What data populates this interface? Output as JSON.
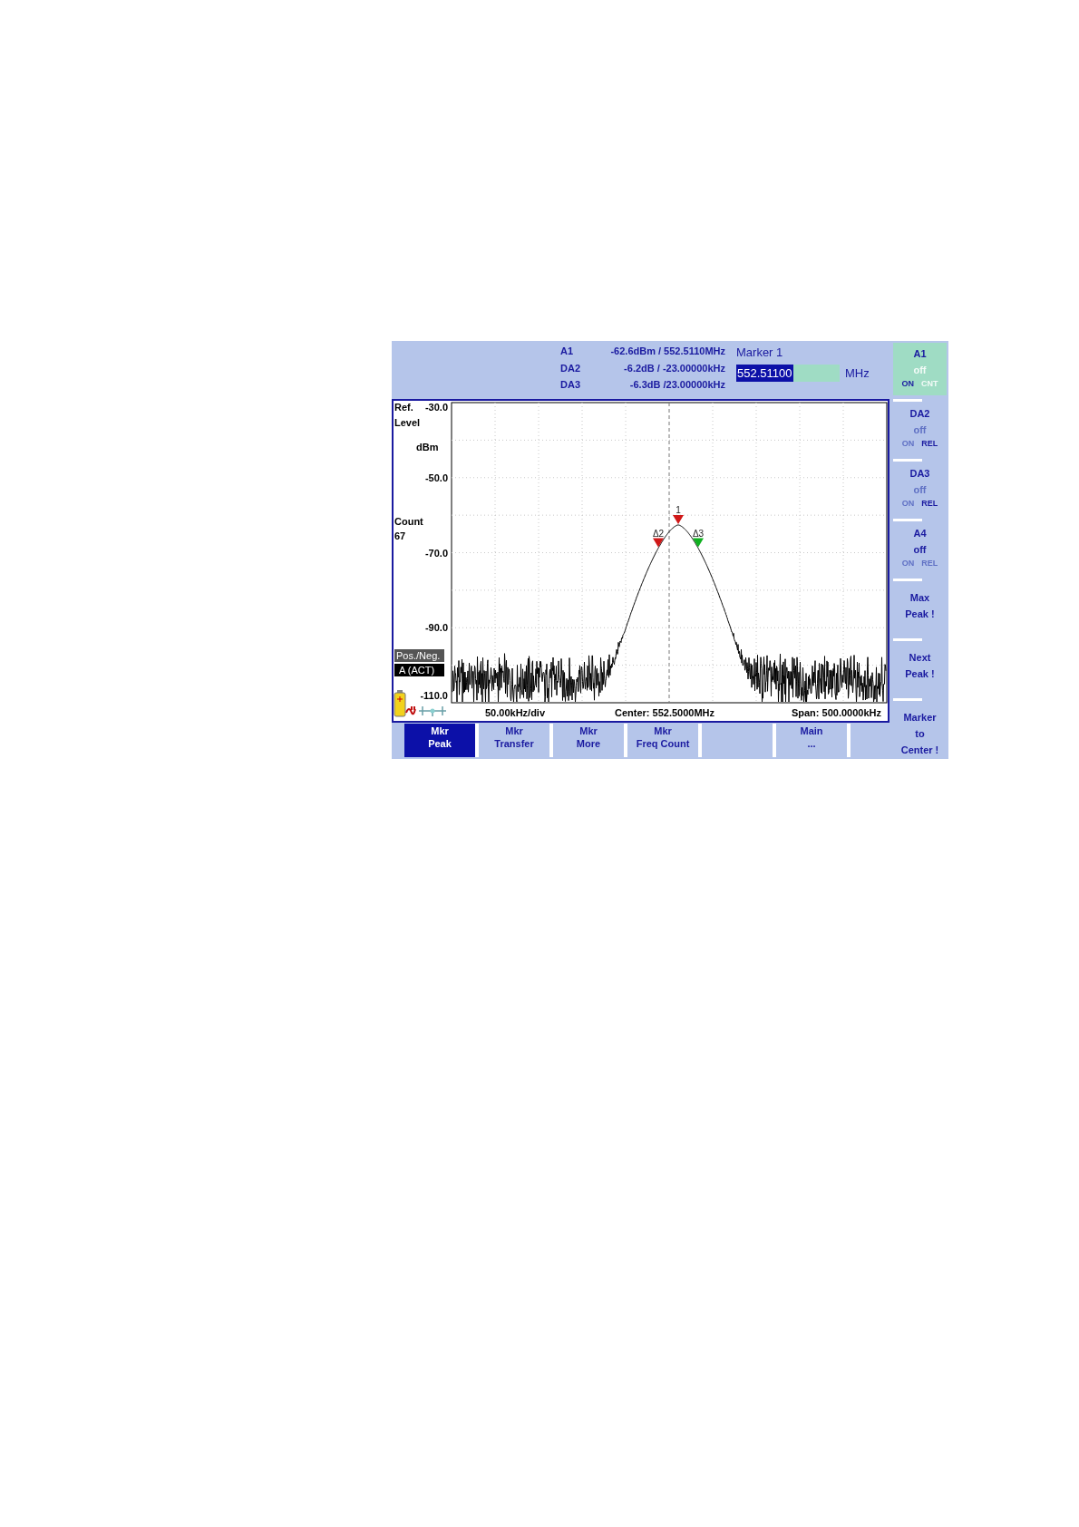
{
  "header": {
    "readouts": [
      {
        "label": "A1",
        "value": "-62.6dBm / 552.5110MHz"
      },
      {
        "label": "DA2",
        "value": "-6.2dB / -23.00000kHz"
      },
      {
        "label": "DA3",
        "value": "-6.3dB /23.00000kHz"
      }
    ],
    "marker_title": "Marker 1",
    "entry": {
      "value": "552.51100",
      "unit": "MHz"
    }
  },
  "display": {
    "ref_label": "Ref.",
    "ref_value": "-30.0",
    "ref_label_2": "Level",
    "unit": "dBm",
    "y_labels": [
      "-50.0",
      "-70.0",
      "-90.0",
      "-110.0"
    ],
    "count_label": "Count",
    "count_value": "67",
    "detector": "Pos./Neg.",
    "trace_mode": "A (ACT)",
    "markers": [
      {
        "label": "1",
        "color": "#d01818"
      },
      {
        "label": "Δ2",
        "color": "#d01818"
      },
      {
        "label": "Δ3",
        "color": "#10b020"
      }
    ],
    "footer": {
      "scale": "50.00kHz/div",
      "center": "Center: 552.5000MHz",
      "span": "Span:  500.0000kHz"
    }
  },
  "side_keys": [
    {
      "kind": "toggle",
      "title": "A1",
      "value": "off",
      "value_dimmed": true,
      "selected": true,
      "options": [
        {
          "label": "ON",
          "active": true
        },
        {
          "label": "CNT",
          "active": false
        }
      ]
    },
    {
      "kind": "toggle",
      "title": "DA2",
      "value": "off",
      "value_dimmed": true,
      "selected": false,
      "options": [
        {
          "label": "ON",
          "active": false
        },
        {
          "label": "REL",
          "active": true
        }
      ]
    },
    {
      "kind": "toggle",
      "title": "DA3",
      "value": "off",
      "value_dimmed": true,
      "selected": false,
      "options": [
        {
          "label": "ON",
          "active": false
        },
        {
          "label": "REL",
          "active": true
        }
      ]
    },
    {
      "kind": "toggle",
      "title": "A4",
      "value": "off",
      "value_dimmed": false,
      "selected": false,
      "options": [
        {
          "label": "ON",
          "active": false
        },
        {
          "label": "REL",
          "active": false
        }
      ]
    },
    {
      "kind": "action",
      "lines": [
        "Max",
        "Peak !"
      ],
      "selected": false
    },
    {
      "kind": "action",
      "lines": [
        "Next",
        "Peak !"
      ],
      "selected": false
    },
    {
      "kind": "action",
      "lines": [
        "Marker",
        "to",
        "Center !"
      ],
      "selected": false
    }
  ],
  "bottom_keys": [
    {
      "kind": "key",
      "lines": [
        "Mkr",
        "Peak"
      ],
      "selected": true
    },
    {
      "kind": "key",
      "lines": [
        "Mkr",
        "Transfer"
      ],
      "selected": false
    },
    {
      "kind": "key",
      "lines": [
        "Mkr",
        "More"
      ],
      "selected": false
    },
    {
      "kind": "key",
      "lines": [
        "Mkr",
        "Freq Count"
      ],
      "selected": false
    },
    {
      "kind": "blank"
    },
    {
      "kind": "key",
      "lines": [
        "Main",
        "..."
      ],
      "selected": false
    }
  ]
}
